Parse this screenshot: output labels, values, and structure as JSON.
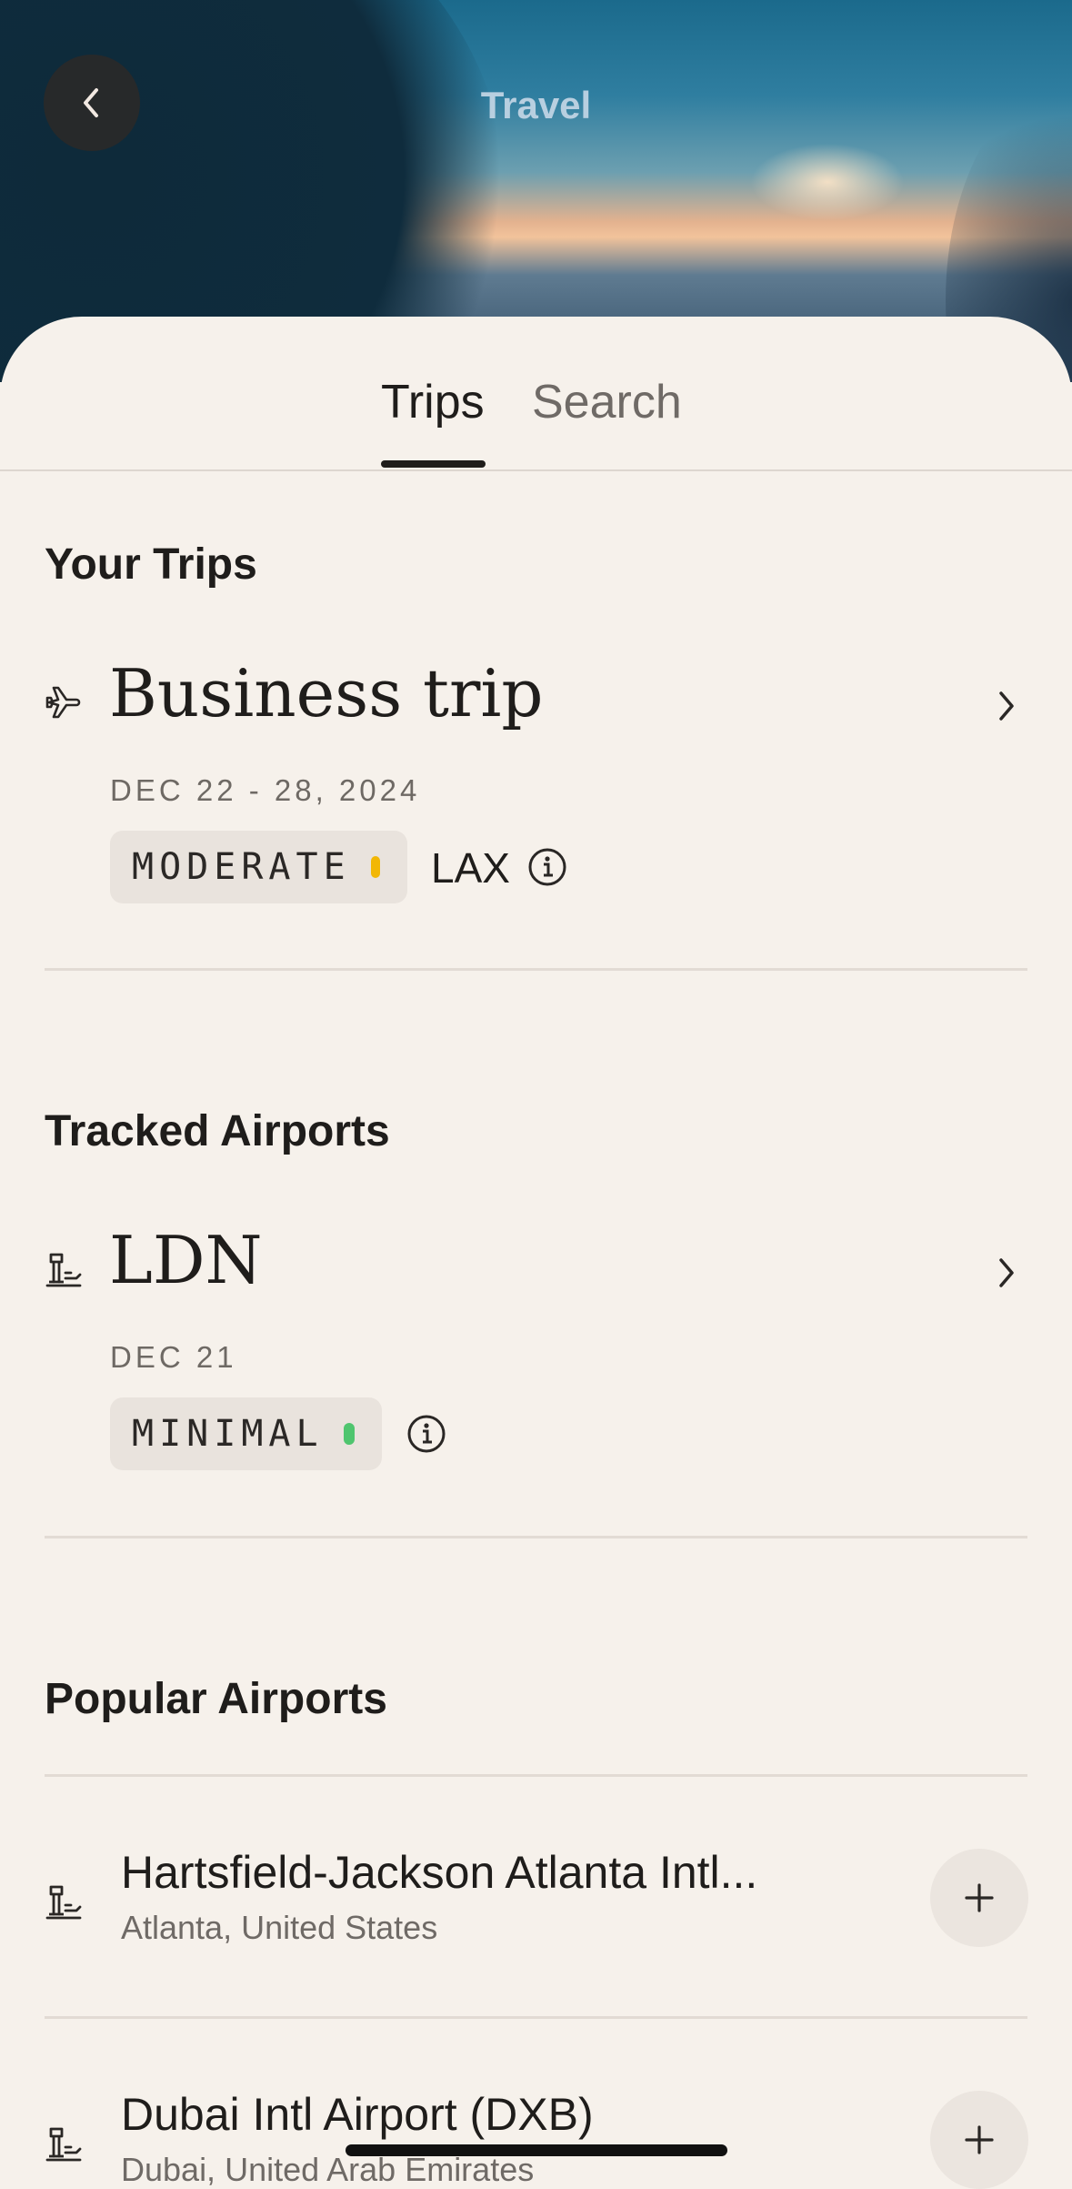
{
  "header": {
    "title": "Travel",
    "back_icon": "chevron-left-icon"
  },
  "tabs": [
    {
      "label": "Trips",
      "active": true
    },
    {
      "label": "Search",
      "active": false
    }
  ],
  "your_trips": {
    "heading": "Your Trips",
    "trip": {
      "icon": "plane-icon",
      "title": "Business trip",
      "dates": "DEC 22 - 28, 2024",
      "status": "MODERATE",
      "status_color": "#f2b705",
      "airport": "LAX"
    }
  },
  "tracked_airports": {
    "heading": "Tracked Airports",
    "airport": {
      "icon": "airport-tower-icon",
      "code": "LDN",
      "date": "DEC 21",
      "status": "MINIMAL",
      "status_color": "#4fc56e"
    }
  },
  "popular_airports": {
    "heading": "Popular Airports",
    "items": [
      {
        "name": "Hartsfield-Jackson Atlanta Intl...",
        "location": "Atlanta, United States"
      },
      {
        "name": "Dubai Intl Airport (DXB)",
        "location": "Dubai, United Arab Emirates"
      }
    ]
  }
}
